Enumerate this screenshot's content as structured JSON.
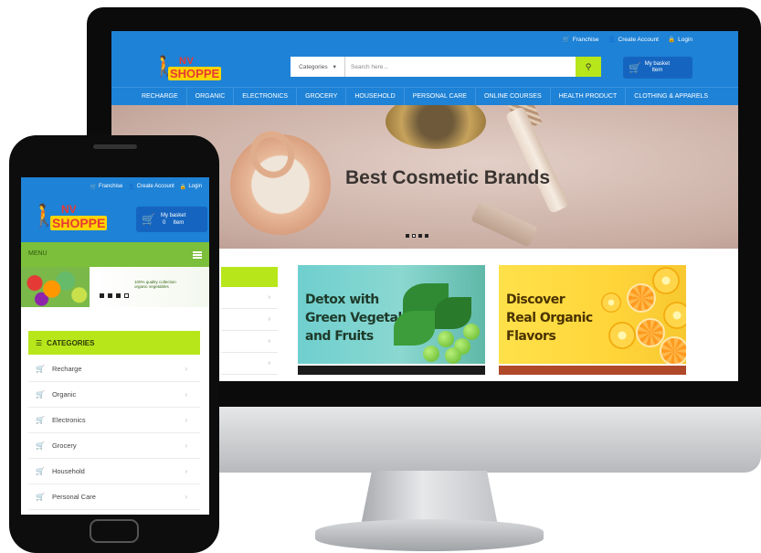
{
  "desktop": {
    "topbar": [
      {
        "icon": "cart-icon",
        "label": "Franchise"
      },
      {
        "icon": "user-icon",
        "label": "Create Account"
      },
      {
        "icon": "lock-icon",
        "label": "Login"
      }
    ],
    "logo": {
      "line1": "NV",
      "line2": "SHOPPE"
    },
    "search": {
      "category": "Categories",
      "placeholder": "Search here..."
    },
    "basket": {
      "line1": "My basket",
      "line2": "Item"
    },
    "nav": [
      "RECHARGE",
      "ORGANIC",
      "ELECTRONICS",
      "GROCERY",
      "HOUSEHOLD",
      "PERSONAL CARE",
      "ONLINE COURSES",
      "HEALTH PRODUCT",
      "CLOTHING & APPARELS"
    ],
    "banner": {
      "title": "Best Cosmetic Brands"
    },
    "promos": [
      {
        "text": "Detox with\nGreen Vegetables\nand Fruits"
      },
      {
        "text": "Discover\nReal Organic\nFlavors"
      }
    ]
  },
  "phone": {
    "topbar": [
      {
        "icon": "cart-icon",
        "label": "Franchise"
      },
      {
        "icon": "user-icon",
        "label": "Create Account"
      },
      {
        "icon": "lock-icon",
        "label": "Login"
      }
    ],
    "logo": {
      "line1": "NV",
      "line2": "SHOPPE"
    },
    "basket": {
      "line1": "My basket",
      "line2": "0     Item"
    },
    "menu_label": "MENU",
    "banner_text": "100% quality collection organic vegetables",
    "categories_title": "CATEGORIES",
    "categories": [
      "Recharge",
      "Organic",
      "Electronics",
      "Grocery",
      "Household",
      "Personal Care"
    ]
  },
  "colors": {
    "primary": "#1e82d6",
    "accent": "#b7e61a",
    "logo_red": "#e53935",
    "logo_yellow": "#ffd400"
  }
}
